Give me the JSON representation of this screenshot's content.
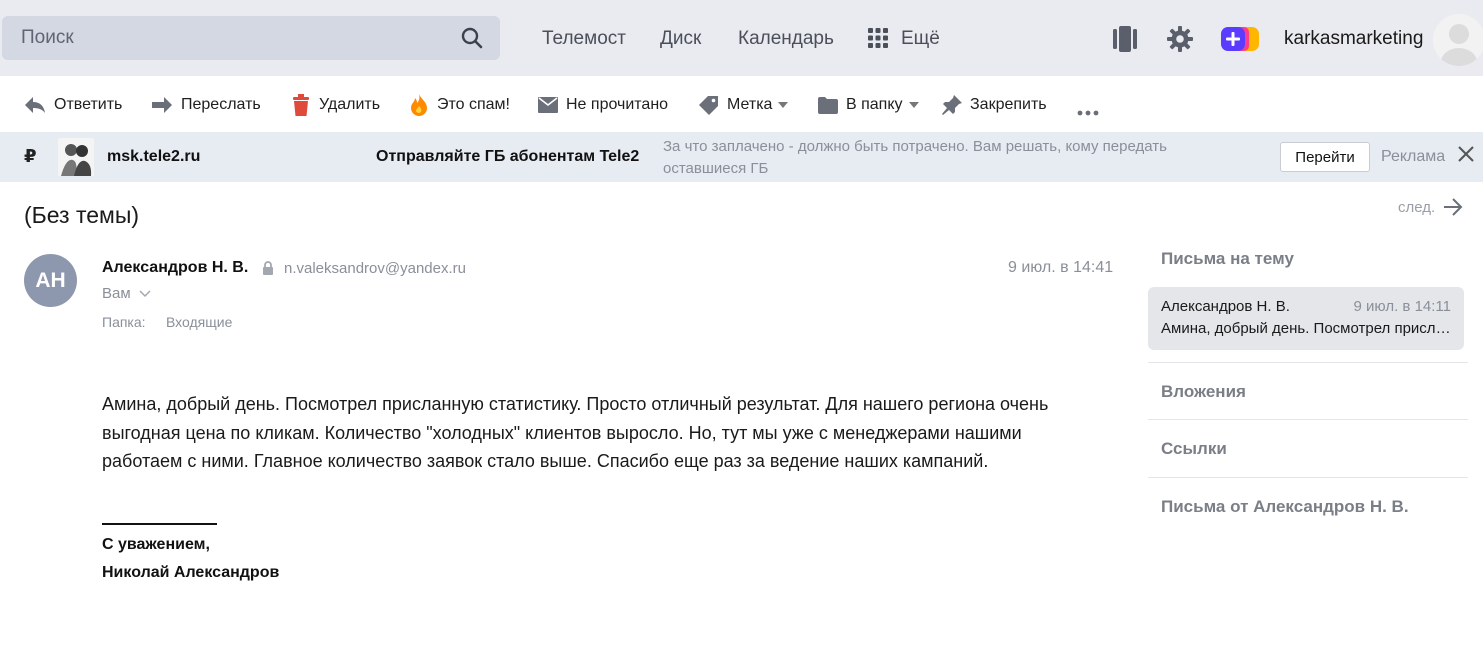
{
  "header": {
    "search_placeholder": "Поиск",
    "nav": [
      "Телемост",
      "Диск",
      "Календарь",
      "Ещё"
    ],
    "username": "karkasmarketing"
  },
  "toolbar": {
    "reply": "Ответить",
    "forward": "Переслать",
    "delete": "Удалить",
    "spam": "Это спам!",
    "unread": "Не прочитано",
    "label": "Метка",
    "folder": "В папку",
    "pin": "Закрепить"
  },
  "ad": {
    "currency": "₽",
    "domain": "msk.tele2.ru",
    "headline": "Отправляйте ГБ абонентам Tele2",
    "text": "За что заплачено - должно быть потрачено. Вам решать, кому передать оставшиеся ГБ",
    "button": "Перейти",
    "label": "Реклама"
  },
  "message": {
    "subject": "(Без темы)",
    "next": "след.",
    "avatar_initials": "АН",
    "sender_name": "Александров Н. В.",
    "sender_email": "n.valeksandrov@yandex.ru",
    "date": "9 июл. в 14:41",
    "to": "Вам",
    "folder_label": "Папка:",
    "folder_value": "Входящие",
    "body": "Амина, добрый день. Посмотрел присланную статистику. Просто отличный результат. Для нашего региона очень выгодная цена по кликам. Количество \"холодных\" клиентов выросло. Но, тут мы уже с менеджерами нашими работаем с ними. Главное количество заявок стало выше. Спасибо еще раз за ведение наших кампаний.",
    "signature_1": "С уважением,",
    "signature_2": "Николай Александров"
  },
  "right_panel": {
    "thread_title": "Письма на тему",
    "thread_item": {
      "from": "Александров Н. В.",
      "date": "9 июл. в 14:11",
      "snippet": "Амина, добрый день. Посмотрел присланную статистику"
    },
    "attachments": "Вложения",
    "links": "Ссылки",
    "from_sender": "Письма от Александров Н. В."
  },
  "icons": [
    "search-icon",
    "grid-icon",
    "notes-icon",
    "gear-icon",
    "plus-icon",
    "avatar",
    "reply-icon",
    "forward-icon",
    "trash-icon",
    "fire-icon",
    "envelope-icon",
    "tag-icon",
    "folder-icon",
    "pin-icon",
    "more-icon",
    "close-icon",
    "arrow-right-icon",
    "lock-icon",
    "chevron-down-icon"
  ],
  "colors": {
    "topbar_bg": "#e9ebf0",
    "search_bg": "#d3d8e2",
    "ad_bg": "#e7ebf2",
    "avatar_bg": "#8d97ad",
    "trash_red": "#e04a3b",
    "fire_orange": "#ff8a00"
  }
}
